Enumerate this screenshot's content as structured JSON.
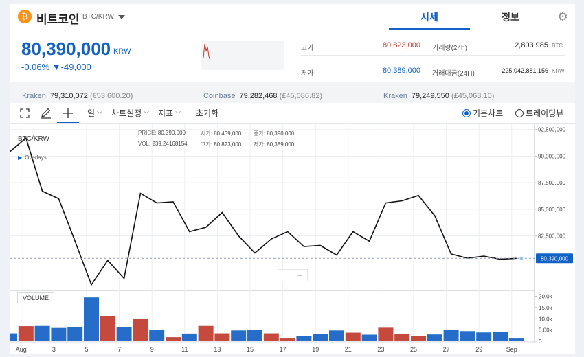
{
  "header": {
    "coin_symbol": "₿",
    "coin_name": "비트코인",
    "pair": "BTC/KRW",
    "tabs": [
      "시세",
      "정보"
    ],
    "active_tab": "시세",
    "settings_icon": "⚙"
  },
  "summary": {
    "price": "80,390,000",
    "unit": "KRW",
    "change": "-0.06% ▼-49,000",
    "high_label": "고가",
    "high_value": "80,823,000",
    "low_label": "저가",
    "low_value": "80,389,000",
    "volume_label": "거래량(24h)",
    "volume_value": "2,803.985",
    "volume_unit": "BTC",
    "amount_label": "거래대금(24H)",
    "amount_value": "225,042,881,156",
    "amount_unit": "KRW"
  },
  "exchanges": [
    {
      "name": "Kraken",
      "value": "79,310,072",
      "fx": "(€53,600.20)"
    },
    {
      "name": "Coinbase",
      "value": "79,282,468",
      "fx": "(£45,086.82)"
    },
    {
      "name": "Kraken",
      "value": "79,249,550",
      "fx": "(£45,068.10)"
    }
  ],
  "toolbar": {
    "interval": "일",
    "chart_settings": "차트설정",
    "indicators": "지표",
    "reset": "초기화",
    "radio_basic": "기본차트",
    "radio_tradingview": "트레이딩뷰",
    "icons": [
      "expand-icon",
      "pencil-icon",
      "crosshair-icon"
    ]
  },
  "ohlc": {
    "price_k": "PRICE:",
    "price_v": "80,390,000",
    "open_k": "시가:",
    "open_v": "80,439,000",
    "close_k": "종가:",
    "close_v": "80,390,000",
    "vol_k": "VOL:",
    "vol_v": "239.24168154",
    "high_k": "고가:",
    "high_v": "80,823,000",
    "low_k": "저가:",
    "low_v": "80,389,000"
  },
  "chart_labels": {
    "pair": "BTC/KRW",
    "overlays": "Overlays",
    "volume": "VOLUME",
    "zoom_out": "−",
    "zoom_in": "+"
  },
  "colors": {
    "accent": "#1261c4",
    "up": "#c0392b",
    "down": "#1261c4",
    "bitcoin": "#f7931a"
  },
  "chart_data": {
    "type": "line",
    "price_series": {
      "x": [
        "Jul 31",
        "Aug 1",
        "Aug 2",
        "Aug 3",
        "Aug 4",
        "Aug 5",
        "Aug 6",
        "Aug 7",
        "Aug 8",
        "Aug 9",
        "Aug 10",
        "Aug 11",
        "Aug 12",
        "Aug 13",
        "Aug 14",
        "Aug 15",
        "Aug 16",
        "Aug 17",
        "Aug 18",
        "Aug 19",
        "Aug 20",
        "Aug 21",
        "Aug 22",
        "Aug 23",
        "Aug 24",
        "Aug 25",
        "Aug 26",
        "Aug 27",
        "Aug 28",
        "Aug 29",
        "Aug 30",
        "Aug 31"
      ],
      "values": [
        90400000,
        91700000,
        86700000,
        86000000,
        82000000,
        77900000,
        80200000,
        78500000,
        86500000,
        85600000,
        85700000,
        82900000,
        83300000,
        84700000,
        82500000,
        80900000,
        82200000,
        82900000,
        81500000,
        81600000,
        80700000,
        82900000,
        82000000,
        85600000,
        85800000,
        86300000,
        84400000,
        80800000,
        80400000,
        80600000,
        80300000,
        80390000
      ]
    },
    "current_price_label": "80,390,000",
    "y_ticks": [
      "92,500,000",
      "90,000,000",
      "87,500,000",
      "85,000,000",
      "82,500,000"
    ],
    "y_range": [
      77500000,
      93000000
    ],
    "x_ticks": [
      "Aug",
      "3",
      "5",
      "7",
      "9",
      "11",
      "13",
      "15",
      "17",
      "19",
      "21",
      "23",
      "25",
      "27",
      "29",
      "Sep"
    ],
    "volume_series": {
      "values": [
        3500,
        6700,
        6800,
        5900,
        6200,
        19500,
        11200,
        6200,
        9800,
        4900,
        1800,
        3400,
        6800,
        3500,
        4800,
        5000,
        3500,
        1200,
        2200,
        3100,
        4800,
        3800,
        2900,
        6000,
        3200,
        2300,
        3000,
        5200,
        4500,
        3900,
        4100,
        1200
      ],
      "direction": [
        "down",
        "up",
        "down",
        "down",
        "down",
        "down",
        "up",
        "down",
        "up",
        "down",
        "up",
        "down",
        "up",
        "up",
        "down",
        "down",
        "up",
        "up",
        "down",
        "down",
        "down",
        "up",
        "down",
        "up",
        "up",
        "up",
        "down",
        "down",
        "down",
        "down",
        "down",
        "down"
      ]
    },
    "volume_ticks": [
      "20.0k",
      "15.0k",
      "10.0k",
      "5.00k",
      "0"
    ],
    "volume_range": [
      0,
      22000
    ],
    "grid": true
  }
}
